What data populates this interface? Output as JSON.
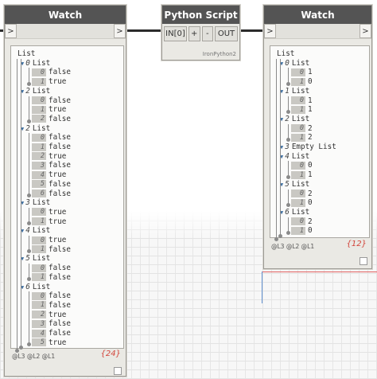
{
  "watch_left": {
    "title": "Watch",
    "in_port": ">",
    "out_port": ">",
    "root_label": "List",
    "groups": [
      {
        "index": "0",
        "label": "List",
        "items": [
          [
            "0",
            "false"
          ],
          [
            "1",
            "true"
          ]
        ]
      },
      {
        "index": "2",
        "label": "List",
        "items": [
          [
            "0",
            "false"
          ],
          [
            "1",
            "true"
          ],
          [
            "2",
            "false"
          ]
        ]
      },
      {
        "index": "2",
        "label": "List",
        "items": [
          [
            "0",
            "false"
          ],
          [
            "1",
            "false"
          ],
          [
            "2",
            "true"
          ],
          [
            "3",
            "false"
          ],
          [
            "4",
            "true"
          ],
          [
            "5",
            "false"
          ],
          [
            "6",
            "false"
          ]
        ]
      },
      {
        "index": "3",
        "label": "List",
        "items": [
          [
            "0",
            "true"
          ],
          [
            "1",
            "true"
          ]
        ]
      },
      {
        "index": "4",
        "label": "List",
        "items": [
          [
            "0",
            "true"
          ],
          [
            "1",
            "false"
          ]
        ]
      },
      {
        "index": "5",
        "label": "List",
        "items": [
          [
            "0",
            "false"
          ],
          [
            "1",
            "false"
          ]
        ]
      },
      {
        "index": "6",
        "label": "List",
        "items": [
          [
            "0",
            "false"
          ],
          [
            "1",
            "false"
          ],
          [
            "2",
            "true"
          ],
          [
            "3",
            "false"
          ],
          [
            "4",
            "false"
          ],
          [
            "5",
            "true"
          ]
        ]
      }
    ],
    "levels": "@L3 @L2 @L1",
    "count": "{24}"
  },
  "python": {
    "title": "Python Script",
    "in_label": "IN[0]",
    "plus_label": "+",
    "minus_label": "-",
    "out_label": "OUT",
    "engine": "IronPython2"
  },
  "watch_right": {
    "title": "Watch",
    "in_port": ">",
    "out_port": ">",
    "root_label": "List",
    "groups": [
      {
        "index": "0",
        "label": "List",
        "items": [
          [
            "0",
            "1"
          ],
          [
            "1",
            "0"
          ]
        ]
      },
      {
        "index": "1",
        "label": "List",
        "items": [
          [
            "0",
            "1"
          ],
          [
            "1",
            "1"
          ]
        ]
      },
      {
        "index": "2",
        "label": "List",
        "items": [
          [
            "0",
            "2"
          ],
          [
            "1",
            "2"
          ]
        ]
      },
      {
        "index": "3",
        "label": "Empty List",
        "items": []
      },
      {
        "index": "4",
        "label": "List",
        "items": [
          [
            "0",
            "0"
          ],
          [
            "1",
            "1"
          ]
        ]
      },
      {
        "index": "5",
        "label": "List",
        "items": [
          [
            "0",
            "2"
          ],
          [
            "1",
            "0"
          ]
        ]
      },
      {
        "index": "6",
        "label": "List",
        "items": [
          [
            "0",
            "2"
          ],
          [
            "1",
            "0"
          ]
        ]
      }
    ],
    "levels": "@L3 @L2 @L1",
    "count": "{12}"
  },
  "colors": {
    "header": "#545454",
    "node_body": "#eae9e4",
    "wire": "#2b2b2b",
    "count": "#d2443a",
    "axis_red": "#e06060",
    "axis_blue": "#6090d0"
  }
}
